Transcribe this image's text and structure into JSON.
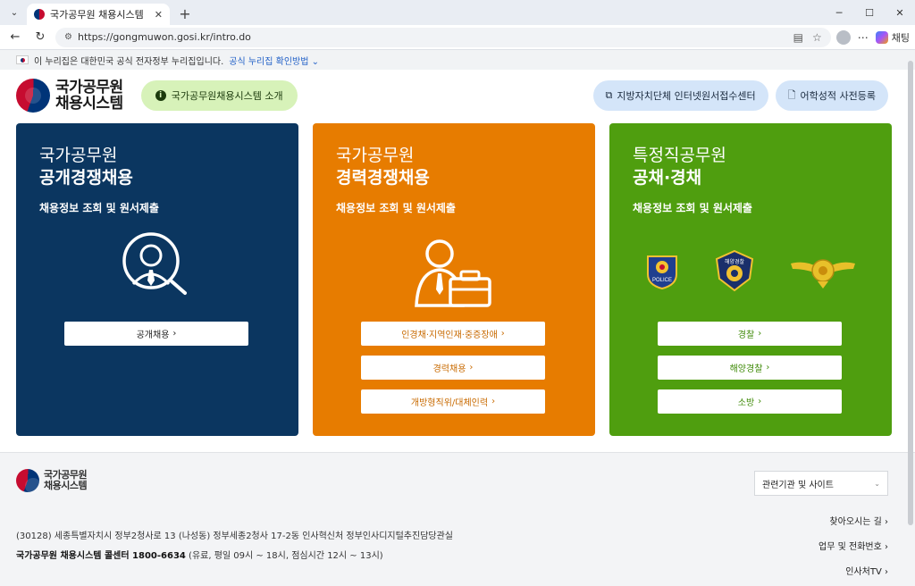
{
  "browser": {
    "tab_title": "국가공무원 채용시스템",
    "url": "https://gongmuwon.gosi.kr/intro.do",
    "copilot_label": "채팅",
    "win_min": "─",
    "win_max": "☐",
    "win_close": "✕"
  },
  "gov_banner": {
    "text": "이 누리집은 대한민국 공식 전자정부 누리집입니다.",
    "link": "공식 누리집 확인방법"
  },
  "header": {
    "logo_line1": "국가공무원",
    "logo_line2": "채용시스템",
    "intro_button": "국가공무원채용시스템 소개",
    "right_buttons": [
      "지방자치단체 인터넷원서접수센터",
      "어학성적 사전등록"
    ]
  },
  "cards": [
    {
      "line1": "국가공무원",
      "line2": "공개경쟁채용",
      "sub": "채용정보 조회 및 원서제출",
      "buttons": [
        "공개채용"
      ]
    },
    {
      "line1": "국가공무원",
      "line2": "경력경쟁채용",
      "sub": "채용정보 조회 및 원서제출",
      "buttons": [
        "인경채·지역인재·중증장애",
        "경력채용",
        "개방형직위/대체인력"
      ]
    },
    {
      "line1": "특정직공무원",
      "line2": "공채·경채",
      "sub": "채용정보 조회 및 원서제출",
      "buttons": [
        "경찰",
        "해양경찰",
        "소방"
      ],
      "emblem_police_text": "POLICE",
      "emblem_coast_text": "해양경찰"
    }
  ],
  "footer": {
    "logo_line1": "국가공무원",
    "logo_line2": "채용시스템",
    "select_value": "관련기관 및 사이트",
    "address": "(30128) 세종특별자치시 정부2청사로 13 (나성동) 정부세종2청사 17-2동 인사혁신처 정부인사디지털추진담당관실",
    "call_bold": "국가공무원 채용시스템 콜센터 1800-6634",
    "call_rest": " (유료, 평일 09시 ~ 18시, 점심시간 12시 ~ 13시)",
    "links": [
      "찾아오시는 길",
      "업무 및 전화번호",
      "인사처TV"
    ]
  },
  "colors": {
    "navy": "#0b3660",
    "orange": "#e77c00",
    "green": "#4f9e0f",
    "intro_green": "#d7f2b9",
    "pill_blue": "#d4e5f9"
  }
}
